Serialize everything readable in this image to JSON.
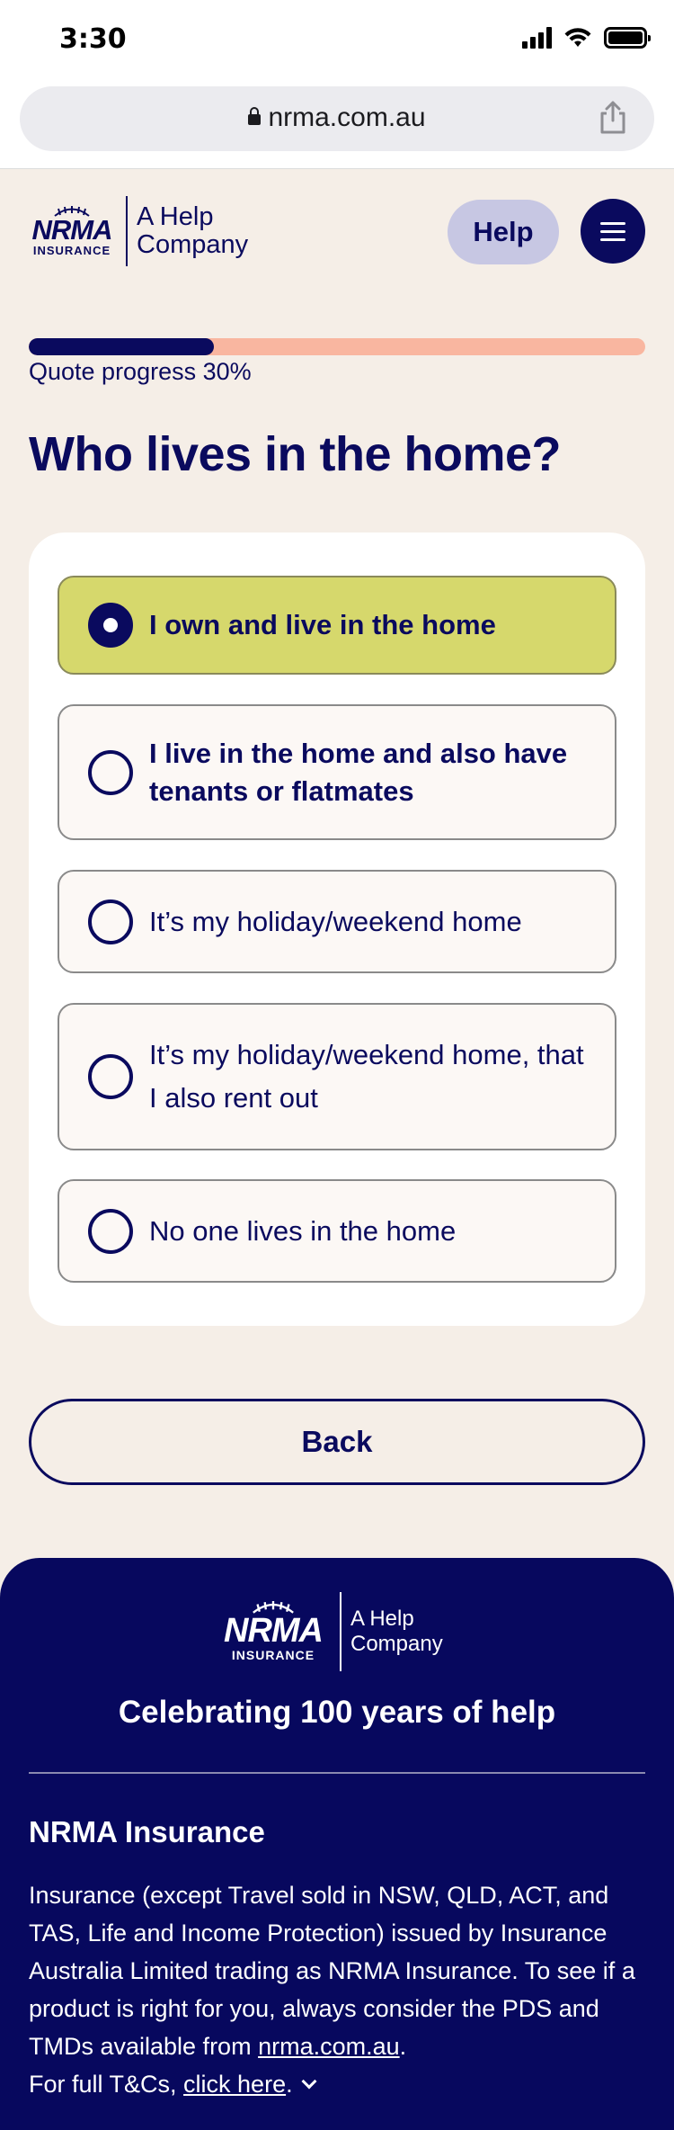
{
  "status_bar": {
    "time": "3:30"
  },
  "browser": {
    "url": "nrma.com.au"
  },
  "header": {
    "logo_word": "NRMA",
    "logo_sub": "INSURANCE",
    "tagline_1": "A Help",
    "tagline_2": "Company",
    "help_label": "Help"
  },
  "progress": {
    "percent": 30,
    "label": "Quote progress 30%"
  },
  "page": {
    "title": "Who lives in the home?"
  },
  "options": [
    {
      "label": "I own and live in the home",
      "selected": true
    },
    {
      "label": "I live in the home and also have tenants or flatmates",
      "selected": false
    },
    {
      "label": "It’s my holiday/weekend home",
      "selected": false
    },
    {
      "label": "It’s my holiday/weekend home, that I also rent out",
      "selected": false
    },
    {
      "label": "No one lives in the home",
      "selected": false
    }
  ],
  "back_label": "Back",
  "footer": {
    "logo_word": "NRMA",
    "logo_sub": "INSURANCE",
    "tagline_1": "A Help",
    "tagline_2": "Company",
    "slogan": "Celebrating 100 years of help",
    "heading": "NRMA Insurance",
    "disclaimer_pre": "Insurance (except Travel sold in NSW, QLD, ACT, and TAS, Life and Income Protection) issued by Insurance Australia Limited trading as NRMA Insurance. To see if a product is right for you, always consider the PDS and TMDs available from ",
    "disclaimer_link": "nrma.com.au",
    "disclaimer_post": ".",
    "tcs_pre": "For full T&Cs, ",
    "tcs_link": "click here",
    "tcs_post": "."
  },
  "colors": {
    "brand_navy": "#0a0a5e",
    "selected_option": "#d6d86c",
    "progress_remaining": "#f9b6a0",
    "page_background": "#f5eee7"
  }
}
